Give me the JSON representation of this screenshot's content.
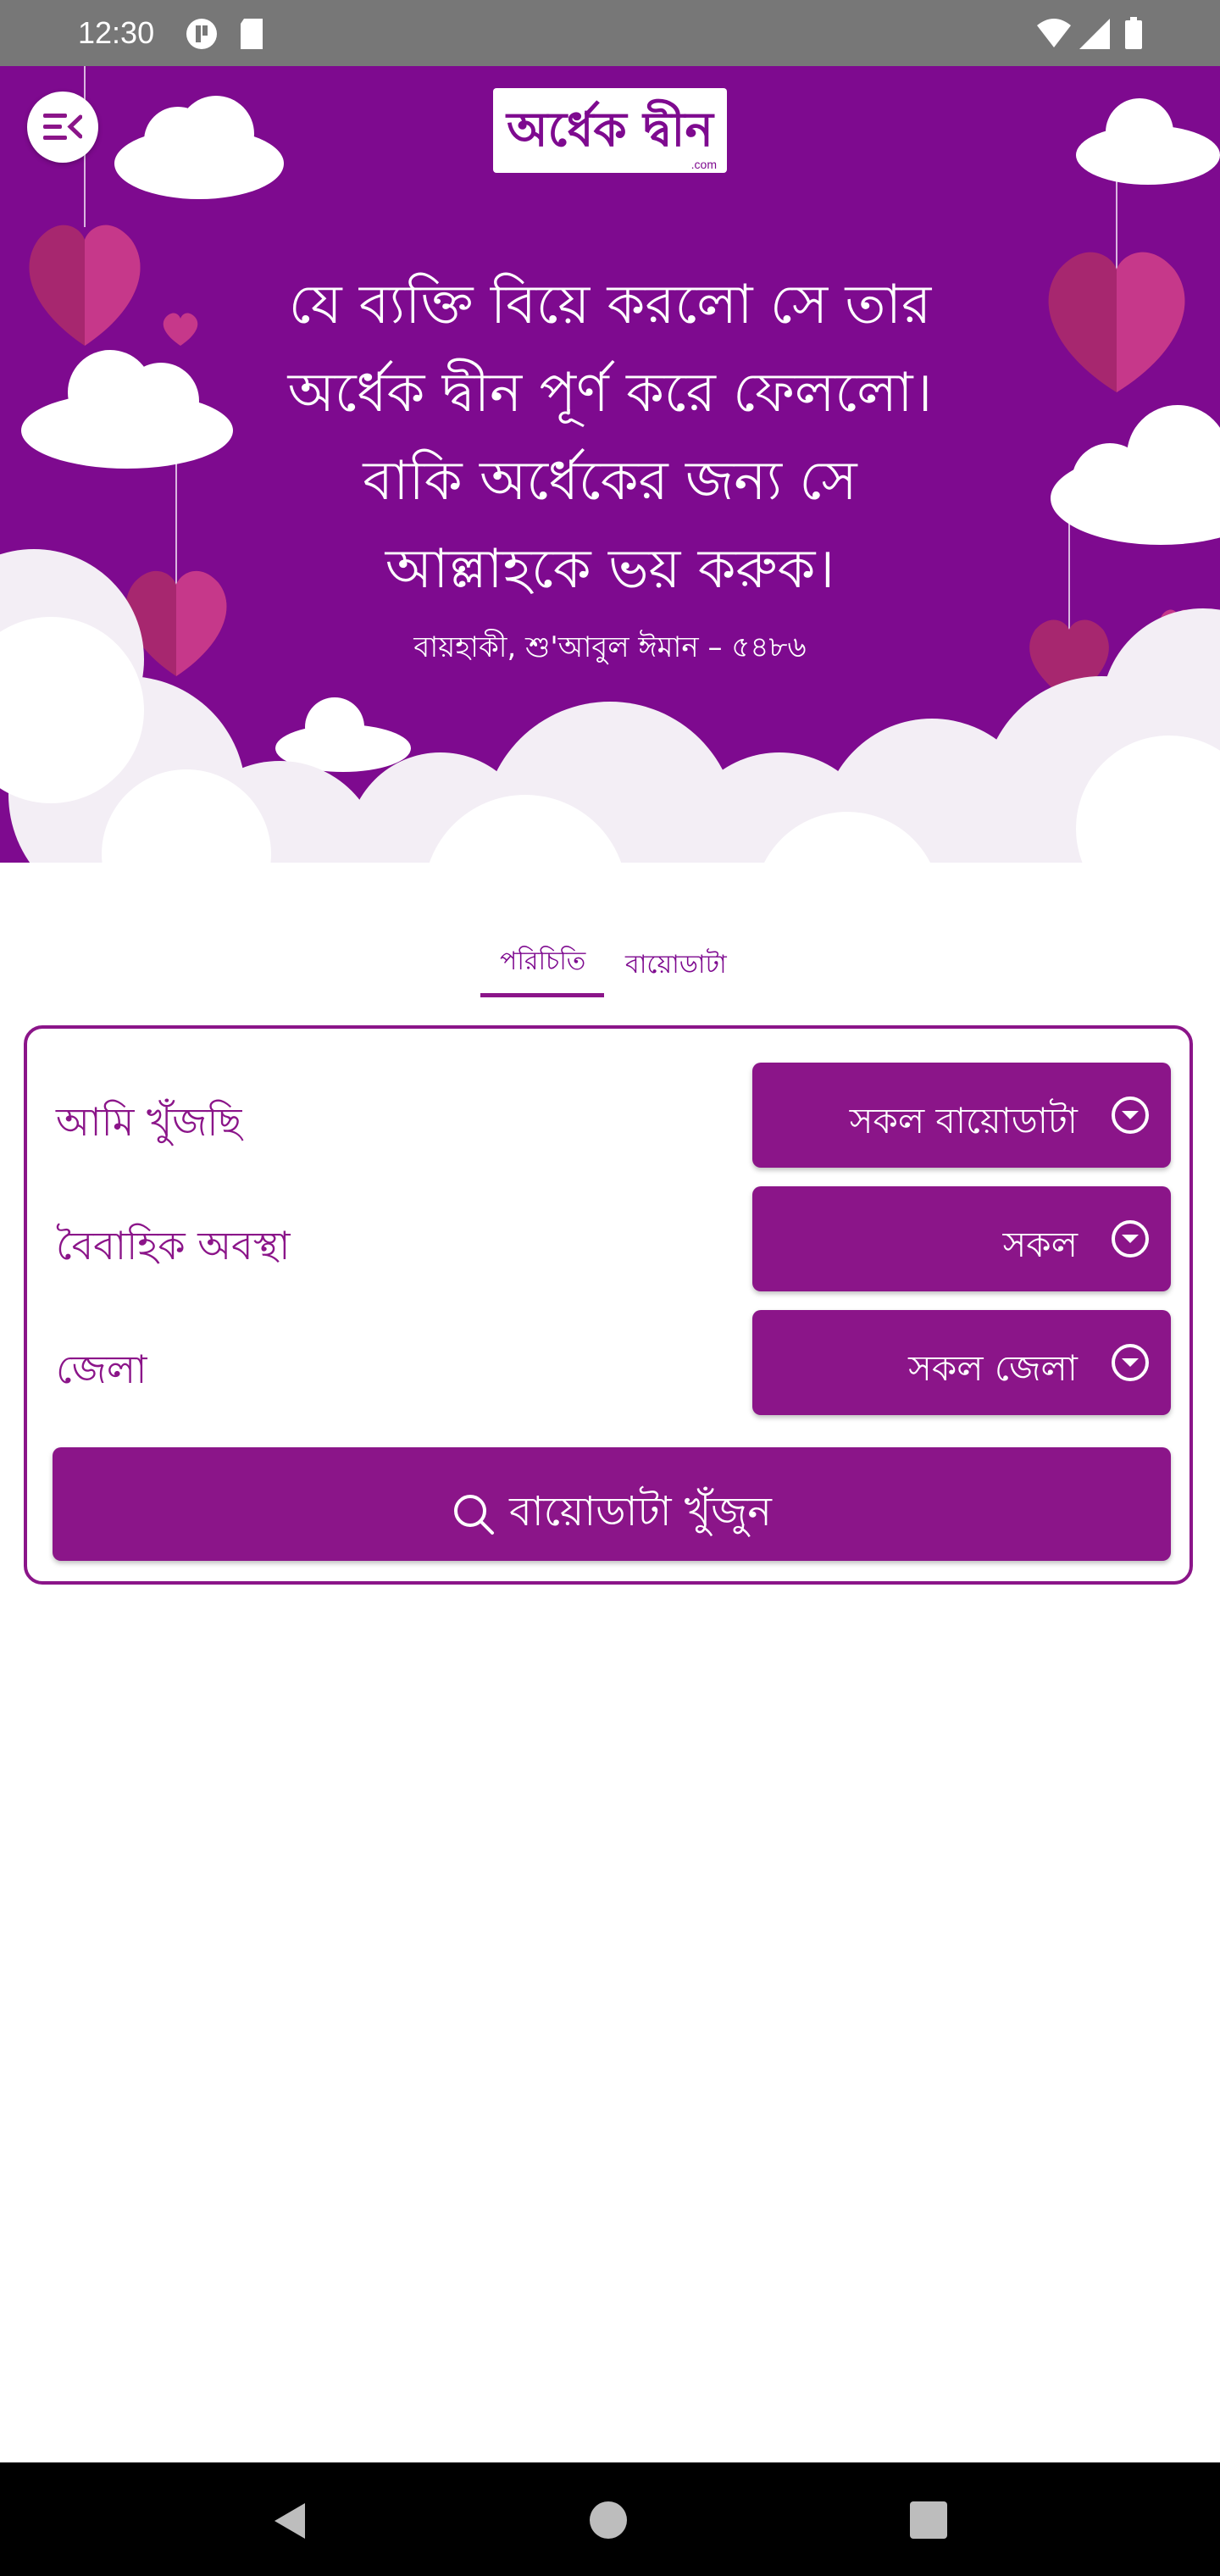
{
  "status_bar": {
    "time": "12:30"
  },
  "header": {
    "logo_text": "অর্ধেক দ্বীন",
    "logo_suffix": ".com",
    "quote_lines": [
      "যে ব্যক্তি বিয়ে করলো সে তার",
      "অর্ধেক দ্বীন পূর্ণ করে ফেললো।",
      "বাকি অর্ধেকের জন্য সে",
      "আল্লাহকে ভয় করুক।"
    ],
    "quote_source": "বায়হাকী, শু'আবুল ঈমান – ৫৪৮৬"
  },
  "tabs": [
    {
      "label": "পরিচিতি",
      "active": true
    },
    {
      "label": "বায়োডাটা",
      "active": false
    }
  ],
  "search_form": {
    "rows": [
      {
        "label": "আমি খুঁজছি",
        "value": "সকল বায়োডাটা"
      },
      {
        "label": "বৈবাহিক অবস্থা",
        "value": "সকল"
      },
      {
        "label": "জেলা",
        "value": "সকল জেলা"
      }
    ],
    "submit_label": "বায়োডাটা খুঁজুন"
  },
  "colors": {
    "brand": "#8b1589",
    "hero_bg": "#7e0a8f"
  }
}
